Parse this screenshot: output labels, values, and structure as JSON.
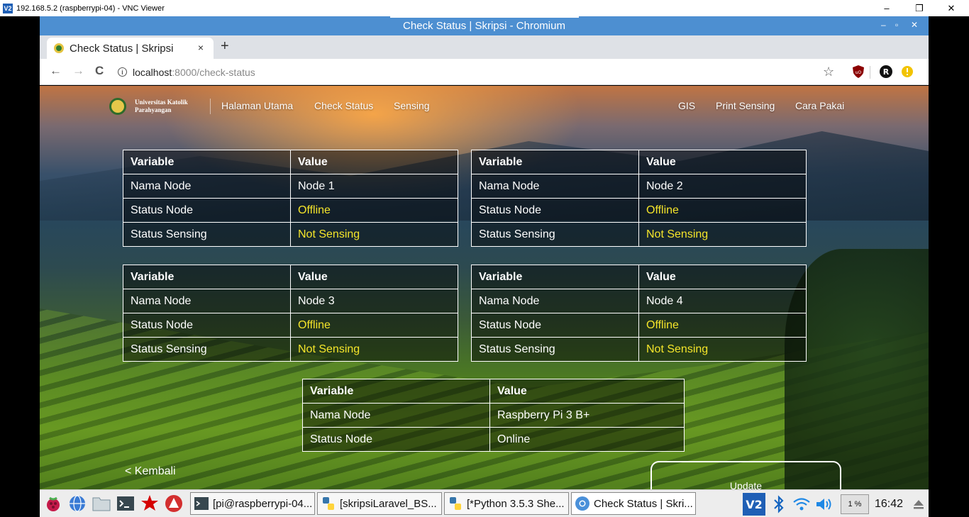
{
  "vnc": {
    "logo": "V2",
    "title": "192.168.5.2 (raspberrypi-04) - VNC Viewer",
    "minimize": "–",
    "restore": "❐",
    "close": "✕"
  },
  "chromium": {
    "window_title": "Check Status | Skripsi - Chromium",
    "min": "–",
    "max": "▫",
    "close": "✕",
    "tab_title": "Check Status | Skripsi",
    "tab_close": "×",
    "new_tab": "+",
    "url_host": "localhost",
    "url_path": ":8000/check-status",
    "back": "←",
    "forward": "→",
    "reload": "C",
    "star": "☆"
  },
  "site": {
    "logo_text_line1": "Universitas Katolik",
    "logo_text_line2": "Parahyangan",
    "nav": {
      "home": "Halaman Utama",
      "check_status": "Check Status",
      "sensing": "Sensing",
      "gis": "GIS",
      "print_sensing": "Print Sensing",
      "guide": "Cara Pakai"
    }
  },
  "tables": {
    "header_variable": "Variable",
    "header_value": "Value",
    "row_nama": "Nama Node",
    "row_status": "Status Node",
    "row_sensing": "Status Sensing",
    "node1": {
      "name": "Node 1",
      "status": "Offline",
      "sensing": "Not Sensing"
    },
    "node2": {
      "name": "Node 2",
      "status": "Offline",
      "sensing": "Not Sensing"
    },
    "node3": {
      "name": "Node 3",
      "status": "Offline",
      "sensing": "Not Sensing"
    },
    "node4": {
      "name": "Node 4",
      "status": "Offline",
      "sensing": "Not Sensing"
    },
    "rpi": {
      "name": "Raspberry Pi 3 B+",
      "status": "Online"
    },
    "status_color_offline": "#f5e52a"
  },
  "actions": {
    "back": "< Kembali",
    "update": "Update"
  },
  "taskbar": {
    "tasks": [
      {
        "label": "[pi@raspberrypi-04...",
        "icon": "terminal-icon"
      },
      {
        "label": "[skripsiLaravel_BS...",
        "icon": "python-icon"
      },
      {
        "label": "[*Python 3.5.3 She...",
        "icon": "python-icon"
      },
      {
        "label": "Check Status | Skri...",
        "icon": "chromium-icon"
      }
    ],
    "cpu": "1 %",
    "clock": "16:42"
  }
}
